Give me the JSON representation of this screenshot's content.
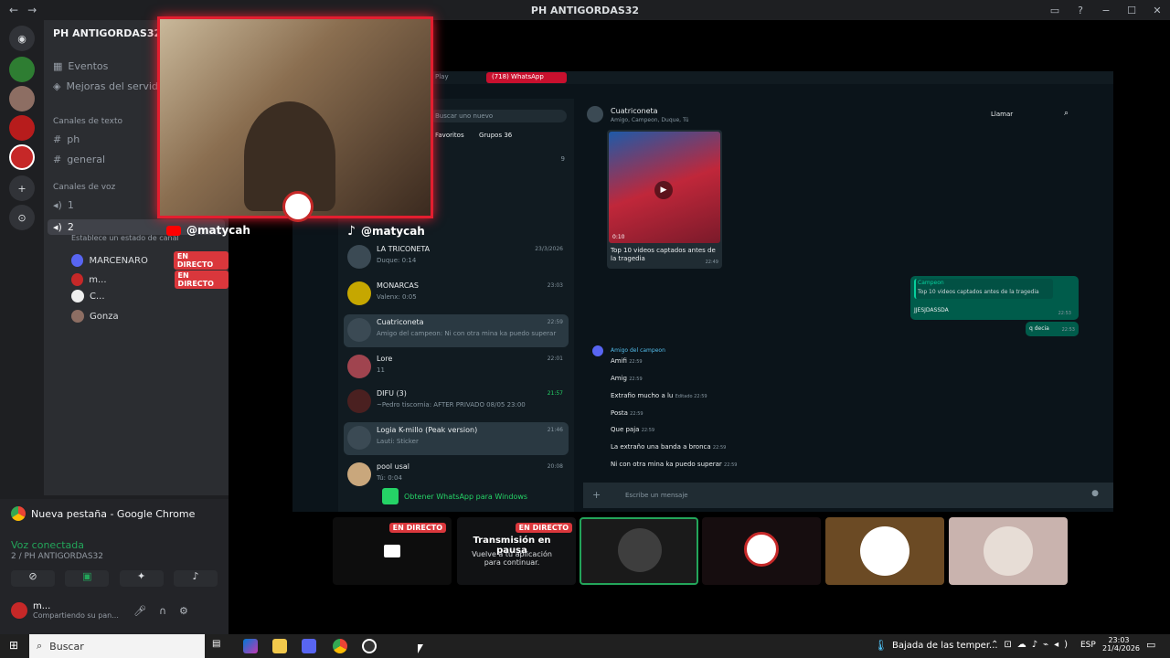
{
  "window": {
    "title": "PH ANTIGORDAS32",
    "back": "←",
    "forward": "→",
    "minimize": "−",
    "maximize": "☐",
    "close": "✕"
  },
  "sidebar": {
    "guild_name": "PH ANTIGORDAS32",
    "events_label": "Eventos",
    "boost_label": "Mejoras del servidor",
    "text_category": "Canales de texto",
    "text_channels": [
      "ph",
      "general"
    ],
    "voice_category": "Canales de voz",
    "voice_channels": [
      "1",
      "2"
    ],
    "voice_status_placeholder": "Establece un estado de canal",
    "voice_users": [
      {
        "name": "MARCENARO",
        "badge": "EN DIRECTO"
      },
      {
        "name": "m...",
        "badge": "EN DIRECTO"
      },
      {
        "name": "C...",
        "badge": ""
      },
      {
        "name": "Gonza",
        "badge": ""
      }
    ]
  },
  "bottom_panel": {
    "stream_title": "Nueva pestaña - Google Chrome",
    "voice_connected": "Voz conectada",
    "voice_channel": "2 / PH ANTIGORDAS32",
    "user_name": "m...",
    "user_status": "Compartiendo su pan..."
  },
  "overlay": {
    "youtube_handle": "@matycah",
    "tiktok_handle": "@matycah"
  },
  "whatsapp": {
    "tab1": "Play",
    "tab2": "(718) WhatsApp",
    "search_placeholder": "Buscar uno nuevo",
    "filters": [
      "Favoritos",
      "Grupos 36"
    ],
    "count_label": "9",
    "chats": [
      {
        "name": "LA TRICONETA",
        "sub": "Duque: 0:14",
        "time": "23/3/2026"
      },
      {
        "name": "MONARCAS",
        "sub": "Valenx: 0:05",
        "time": "23:03"
      },
      {
        "name": "Cuatriconeta",
        "sub": "Amigo del campeon: Ni con otra mina ka puedo superar",
        "time": "22:59"
      },
      {
        "name": "Lore",
        "sub": "11",
        "time": "22:01"
      },
      {
        "name": "DIFU (3)",
        "sub": "~Pedro tiscornia: AFTER PRIVADO 08/05 23:00",
        "time": "21:57"
      },
      {
        "name": "Logia K-millo (Peak version)",
        "sub": "Lauti: Sticker",
        "time": "21:46"
      },
      {
        "name": "pool usal",
        "sub": "Tú: 0:04",
        "time": "20:08"
      }
    ],
    "get_windows": "Obtener WhatsApp para Windows",
    "conv_name": "Cuatriconeta",
    "conv_members": "Amigo, Campeon, Duque, Tú",
    "call_label": "Llamar",
    "video_duration": "0:10",
    "video_caption": "Top 10 videos captados antes de la tragedia",
    "video_time": "22:49",
    "out_quote_author": "Campeon",
    "out_quote_text": "Top 10 videos captados antes de la tragedia",
    "out_msg1": "JJESJDASSDA",
    "out_time1": "22:53",
    "out_msg2": "q decia",
    "out_time2": "22:53",
    "in_author": "Amigo del campeon",
    "in_msgs": [
      {
        "text": "Amifi",
        "time": "22:59"
      },
      {
        "text": "Amig",
        "time": "22:59"
      },
      {
        "text": "Extrafio mucho a lu",
        "time": "Editado 22:59"
      },
      {
        "text": "Posta",
        "time": "22:59"
      },
      {
        "text": "Que paja",
        "time": "22:59"
      },
      {
        "text": "La extraño una banda a bronca",
        "time": "22:59"
      },
      {
        "text": "Ni con otra mina ka puedo superar",
        "time": "22:59"
      }
    ],
    "compose_placeholder": "Escribe un mensaje"
  },
  "stream_tiles": {
    "badge": "EN DIRECTO",
    "paused_title": "Transmisión en pausa",
    "paused_sub": "Vuelve a tu aplicación para continuar."
  },
  "taskbar": {
    "search_placeholder": "Buscar",
    "weather": "Bajada de las temper...",
    "lang": "ESP",
    "time": "23:03",
    "date": "21/4/2026"
  },
  "colors": {
    "live_red": "#da373c",
    "discord_blurple": "#5865f2",
    "whatsapp_green": "#25d366",
    "cam_border": "#e31e2f"
  }
}
